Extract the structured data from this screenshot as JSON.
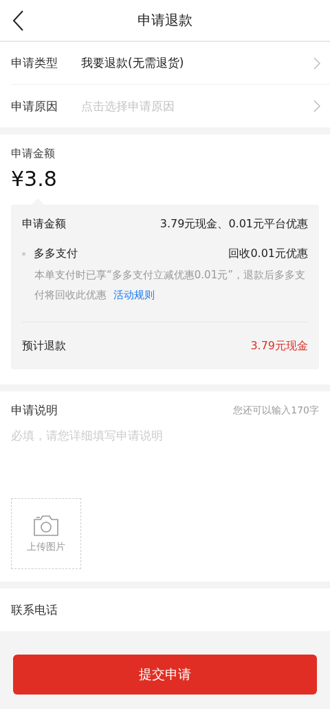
{
  "header": {
    "title": "申请退款"
  },
  "form_rows": [
    {
      "kind": "value",
      "label": "申请类型",
      "text": "我要退款(无需退货)"
    },
    {
      "kind": "placeholder",
      "label": "申请原因",
      "text": "点击选择申请原因"
    }
  ],
  "amount": {
    "label": "申请金额",
    "value": "¥3.8"
  },
  "breakdown": {
    "label": "申请金额",
    "value": "3.79元现金、0.01元平台优惠",
    "items": [
      {
        "name": "多多支付",
        "value": "回收0.01元优惠",
        "note": "本单支付时已享“多多支付立减优惠0.01元”，退款后多多支付将回收此优惠",
        "link": "活动规则"
      }
    ],
    "total": {
      "label": "预计退款",
      "value": "3.79元现金"
    }
  },
  "description": {
    "label": "申请说明",
    "counter": "您还可以输入170字",
    "placeholder": "必填，请您详细填写申请说明",
    "upload_label": "上传图片"
  },
  "contact": {
    "label": "联系电话"
  },
  "submit": "提交申请"
}
